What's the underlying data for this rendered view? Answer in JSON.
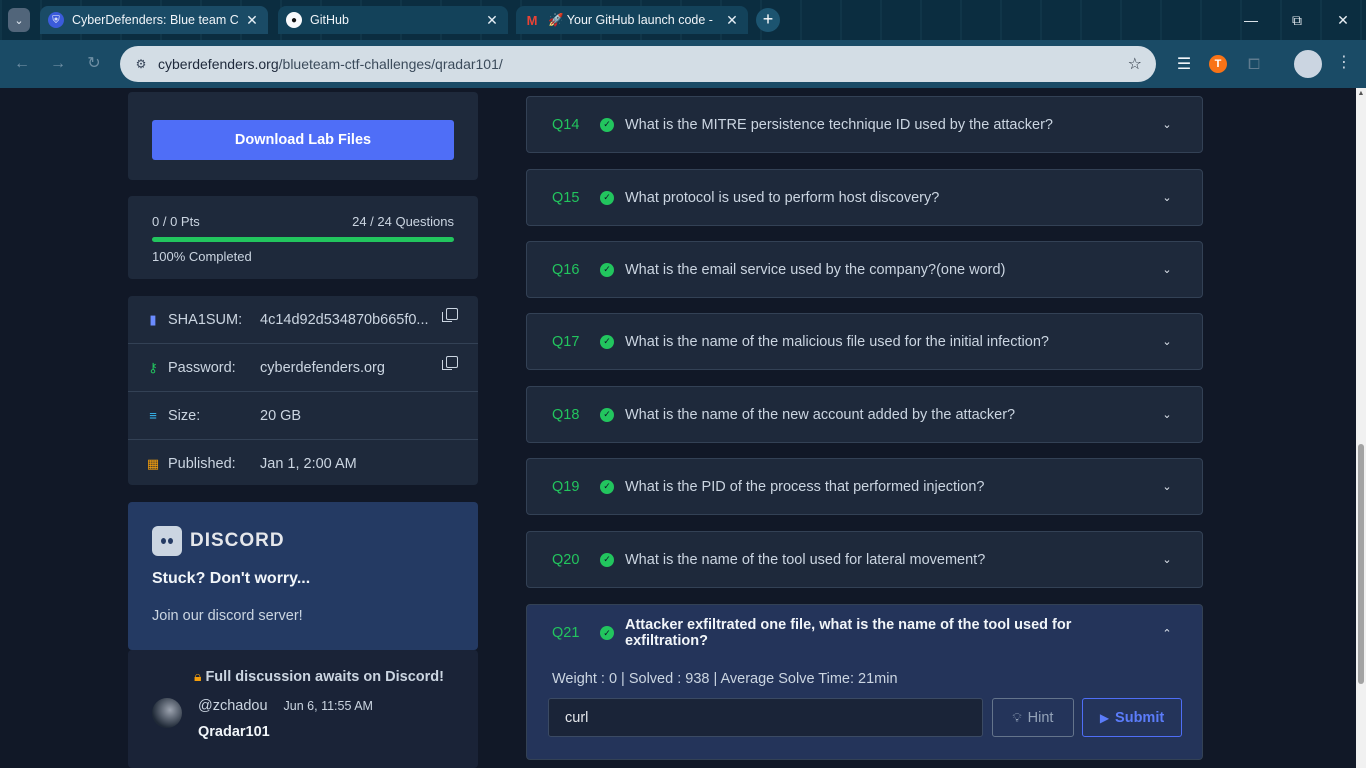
{
  "browser": {
    "tabs": [
      {
        "title": "CyberDefenders: Blue team CTF",
        "active": true,
        "favicon": "cyberdefenders-icon"
      },
      {
        "title": "GitHub",
        "active": false,
        "favicon": "github-icon"
      },
      {
        "title": "🚀 Your GitHub launch code - ",
        "active": false,
        "favicon": "gmail-icon"
      }
    ],
    "url_host": "cyberdefenders.org",
    "url_path": "/blueteam-ctf-challenges/qradar101/"
  },
  "sidebar": {
    "download_label": "Download Lab Files",
    "points": "0 / 0 Pts",
    "questions": "24 / 24 Questions",
    "progress": 1.0,
    "completed_label": "100% Completed",
    "meta": [
      {
        "label": "SHA1SUM:",
        "value": "4c14d92d534870b665f0...",
        "icon": "file-icon",
        "copy": true
      },
      {
        "label": "Password:",
        "value": "cyberdefenders.org",
        "icon": "key-icon",
        "copy": true
      },
      {
        "label": "Size:",
        "value": "20 GB",
        "icon": "database-icon",
        "copy": false
      },
      {
        "label": "Published:",
        "value": "Jan 1, 2:00 AM",
        "icon": "calendar-icon",
        "copy": false
      }
    ],
    "discord": {
      "wordmark": "DISCORD",
      "headline": "Stuck? Don't worry...",
      "sub": "Join our discord server!"
    },
    "discussion": {
      "banner": "Full discussion awaits on Discord!",
      "user": "@zchadou",
      "time": "Jun 6, 11:55 AM",
      "message": "Qradar101"
    }
  },
  "questions": [
    {
      "id": "Q14",
      "text": "What is the MITRE persistence technique ID used by the attacker?"
    },
    {
      "id": "Q15",
      "text": "What protocol is used to perform host discovery?"
    },
    {
      "id": "Q16",
      "text": "What is the email service used by the company?(one word)"
    },
    {
      "id": "Q17",
      "text": "What is the name of the malicious file used for the initial infection?"
    },
    {
      "id": "Q18",
      "text": "What is the name of the new account added by the attacker?"
    },
    {
      "id": "Q19",
      "text": "What is the PID of the process that performed injection?"
    },
    {
      "id": "Q20",
      "text": "What is the name of the tool used for lateral movement?"
    }
  ],
  "open_question": {
    "id": "Q21",
    "text": "Attacker exfiltrated one file, what is the name of the tool used for exfiltration?",
    "stats": "Weight : 0 | Solved : 938 | Average Solve Time: 21min",
    "answer": "curl",
    "hint_label": "Hint",
    "submit_label": "Submit"
  }
}
